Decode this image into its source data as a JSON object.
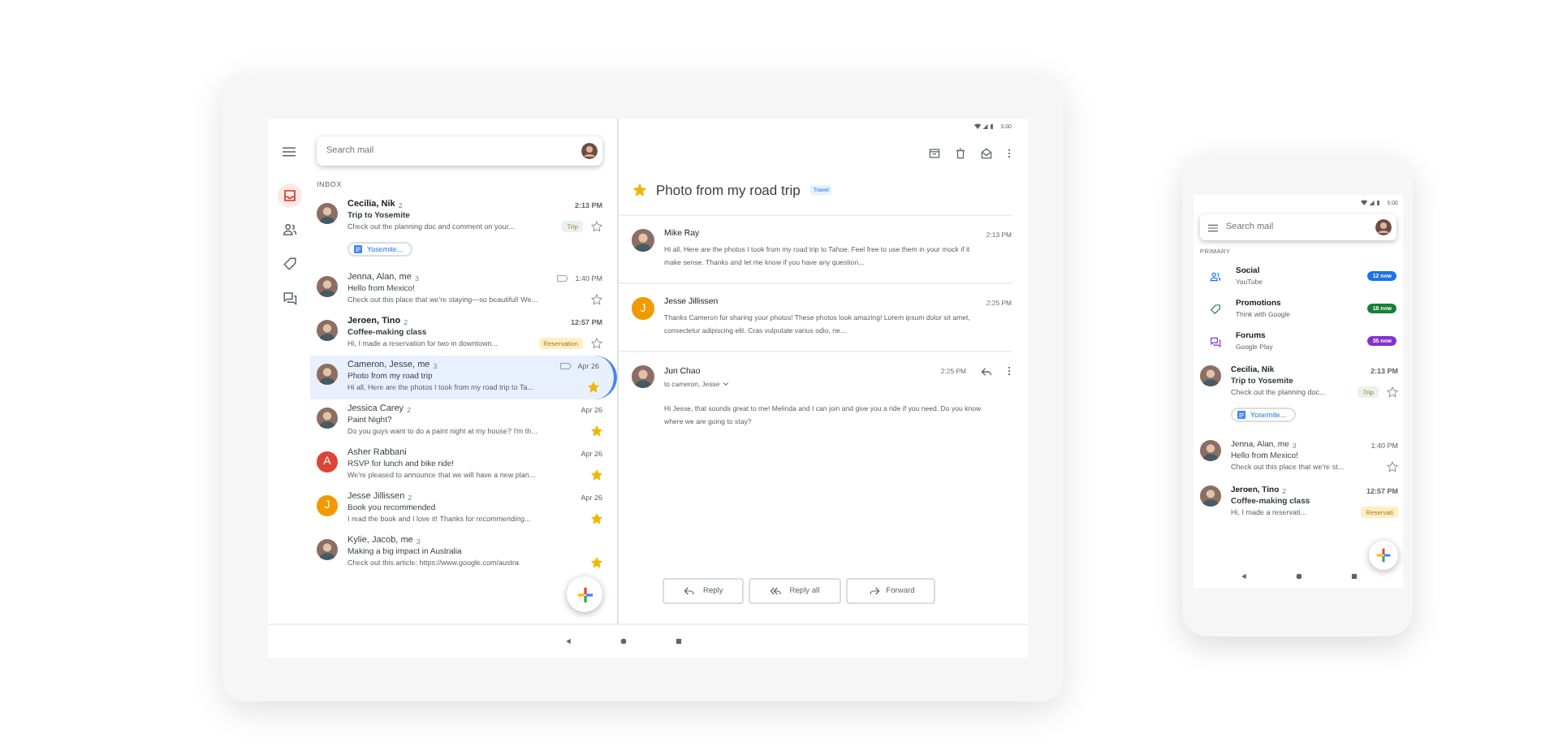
{
  "tablet": {
    "search": {
      "placeholder": "Search mail"
    },
    "nav": [
      {
        "kind": "inbox",
        "selected": true
      },
      {
        "kind": "people",
        "selected": false
      },
      {
        "kind": "label",
        "selected": false
      },
      {
        "kind": "forum",
        "selected": false
      }
    ],
    "section": "INBOX",
    "emails": [
      {
        "sender": "Cecilia, Nik",
        "count": "2",
        "time": "2:13 PM",
        "subject": "Trip to Yosemite",
        "snippet": "Check out the planning doc and comment on your...",
        "unread": true,
        "marker": false,
        "starred": false,
        "selected": false,
        "avatar": {
          "kind": "photo"
        },
        "label": {
          "text": "Trip",
          "color": "#e6f4ea"
        },
        "attachment": "Yosemite..."
      },
      {
        "sender": "Jenna, Alan, me",
        "count": "3",
        "time": "1:40 PM",
        "subject": "Hello from Mexico!",
        "snippet": "Check out this place that we're staying—so beautiful! We...",
        "unread": false,
        "marker": true,
        "starred": false,
        "selected": false,
        "avatar": {
          "kind": "photo"
        }
      },
      {
        "sender": "Jeroen, Tino",
        "count": "2",
        "time": "12:57 PM",
        "subject": "Coffee-making class",
        "snippet": "Hi, I made a reservation for two in downtown...",
        "unread": true,
        "marker": false,
        "starred": false,
        "selected": false,
        "avatar": {
          "kind": "photo"
        },
        "label": {
          "text": "Reservation",
          "color": "#feefc3"
        }
      },
      {
        "sender": "Cameron, Jesse, me",
        "count": "3",
        "time": "Apr 26",
        "subject": "Photo from my road trip",
        "snippet": "Hi all, Here are the photos I took from my road trip to Ta...",
        "unread": false,
        "marker": true,
        "starred": true,
        "selected": true,
        "avatar": {
          "kind": "photo"
        }
      },
      {
        "sender": "Jessica Carey",
        "count": "2",
        "time": "Apr 26",
        "subject": "Paint Night?",
        "snippet": "Do you guys want to do a paint night at my house? I'm th...",
        "unread": false,
        "marker": false,
        "starred": true,
        "selected": false,
        "avatar": {
          "kind": "photo"
        }
      },
      {
        "sender": "Asher Rabbani",
        "time": "Apr 26",
        "subject": "RSVP for lunch and bike ride!",
        "snippet": "We're pleased to announce that we will have a new plan...",
        "unread": false,
        "marker": false,
        "starred": true,
        "selected": false,
        "avatar": {
          "kind": "letter",
          "letter": "A",
          "color": "#db4437"
        }
      },
      {
        "sender": "Jesse Jillissen",
        "count": "2",
        "time": "Apr 26",
        "subject": "Book you recommended",
        "snippet": "I read the book and I love it! Thanks for recommending...",
        "unread": false,
        "marker": false,
        "starred": true,
        "selected": false,
        "avatar": {
          "kind": "letter",
          "letter": "J",
          "color": "#f29900"
        }
      },
      {
        "sender": "Kylie, Jacob, me",
        "count": "3",
        "subject": "Making a big impact in Australia",
        "snippet": "Check out this article: https://www.google.com/austra",
        "unread": false,
        "marker": false,
        "starred": true,
        "selected": false,
        "avatar": {
          "kind": "photo"
        }
      }
    ],
    "status_time": "5:00",
    "thread": {
      "subject": "Photo from my road trip",
      "tag": "Travel",
      "starred": true
    },
    "messages": [
      {
        "sender": "Mike Ray",
        "time": "2:13 PM",
        "body": "Hi all, Here are the photos I took from my road trip to Tahoe. Feel free to use them in your mock if it make sense. Thanks and let me know if you have any question...",
        "expanded": false,
        "avatar": {
          "kind": "photo"
        }
      },
      {
        "sender": "Jesse Jillissen",
        "time": "2:25 PM",
        "body": "Thanks Cameron for sharing your photos! These photos look amazing! Lorem ipsum dolor sit amet, consectetur adipiscing elit. Cras vulputate varius odio, ne...",
        "expanded": false,
        "avatar": {
          "kind": "letter",
          "letter": "J",
          "color": "#f29900"
        }
      },
      {
        "sender": "Jun Chao",
        "time": "2:25 PM",
        "recipients": "to cameron, Jesse",
        "body": "Hi Jesse, that sounds great to me! Melinda and I can join and give you a ride if you need. Do you know where we are going to stay?",
        "expanded": true,
        "avatar": {
          "kind": "photo"
        }
      }
    ],
    "actions": [
      {
        "kind": "reply",
        "label": "Reply"
      },
      {
        "kind": "reply_all",
        "label": "Reply all"
      },
      {
        "kind": "forward",
        "label": "Forward"
      }
    ]
  },
  "phone": {
    "status_time": "5:00",
    "search": {
      "placeholder": "Search mail"
    },
    "section": "PRIMARY",
    "categories": [
      {
        "kind": "social",
        "name": "Social",
        "from": "YouTube",
        "badge": "12 new",
        "color": "#1a73e8"
      },
      {
        "kind": "promotions",
        "name": "Promotions",
        "from": "Think with Google",
        "badge": "18 new",
        "color": "#188038"
      },
      {
        "kind": "forums",
        "name": "Forums",
        "from": "Google Play",
        "badge": "35 new",
        "color": "#8430ce"
      }
    ],
    "emails": [
      {
        "sender": "Cecilia, Nik",
        "time": "2:13 PM",
        "subject": "Trip to Yosemite",
        "snippet": "Check out the planning doc...",
        "unread": true,
        "starred": false,
        "label": {
          "text": "Trip",
          "color": "#e6f4ea"
        },
        "attachment": "Yosemite..."
      },
      {
        "sender": "Jenna, Alan, me",
        "count": "3",
        "time": "1:40 PM",
        "subject": "Hello from Mexico!",
        "snippet": "Check out this place that we're st...",
        "unread": false,
        "starred": false
      },
      {
        "sender": "Jeroen, Tino",
        "count": "2",
        "time": "12:57 PM",
        "subject": "Coffee-making class",
        "snippet": "Hi, I made a reservati...",
        "unread": true,
        "label": {
          "text": "Reservati",
          "color": "#feefc3"
        }
      }
    ]
  }
}
